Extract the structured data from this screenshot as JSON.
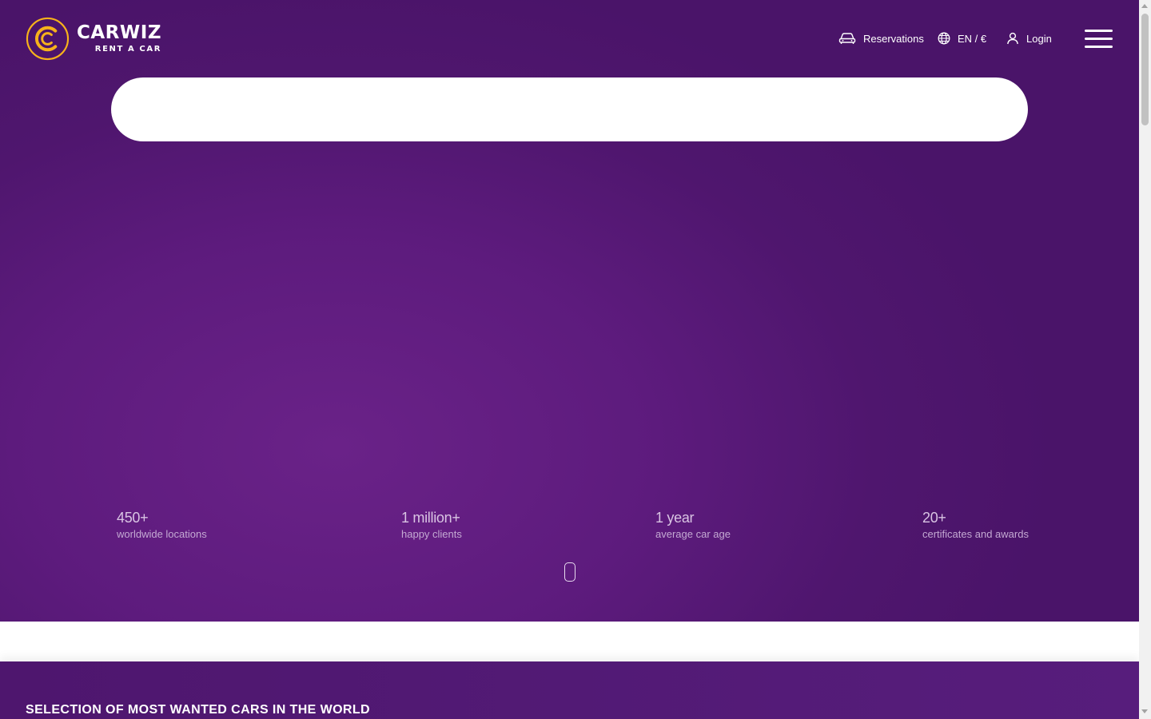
{
  "brand": {
    "name": "CARWIZ",
    "tagline": "RENT A CAR",
    "accent_color": "#f7b21b",
    "primary_color": "#5d1b7d"
  },
  "header": {
    "reservations": {
      "label": "Reservations",
      "icon": "car-icon"
    },
    "language": {
      "label": "EN / €",
      "icon": "globe-icon"
    },
    "login": {
      "label": "Login",
      "icon": "user-icon"
    },
    "menu_icon": "hamburger-icon"
  },
  "stats": [
    {
      "value": "450+",
      "label": "worldwide locations"
    },
    {
      "value": "1 million+",
      "label": "happy clients"
    },
    {
      "value": "1 year",
      "label": "average car age"
    },
    {
      "value": "20+",
      "label": "certificates and awards"
    }
  ],
  "sections": {
    "cars_heading": "SELECTION OF MOST WANTED CARS IN THE WORLD"
  }
}
